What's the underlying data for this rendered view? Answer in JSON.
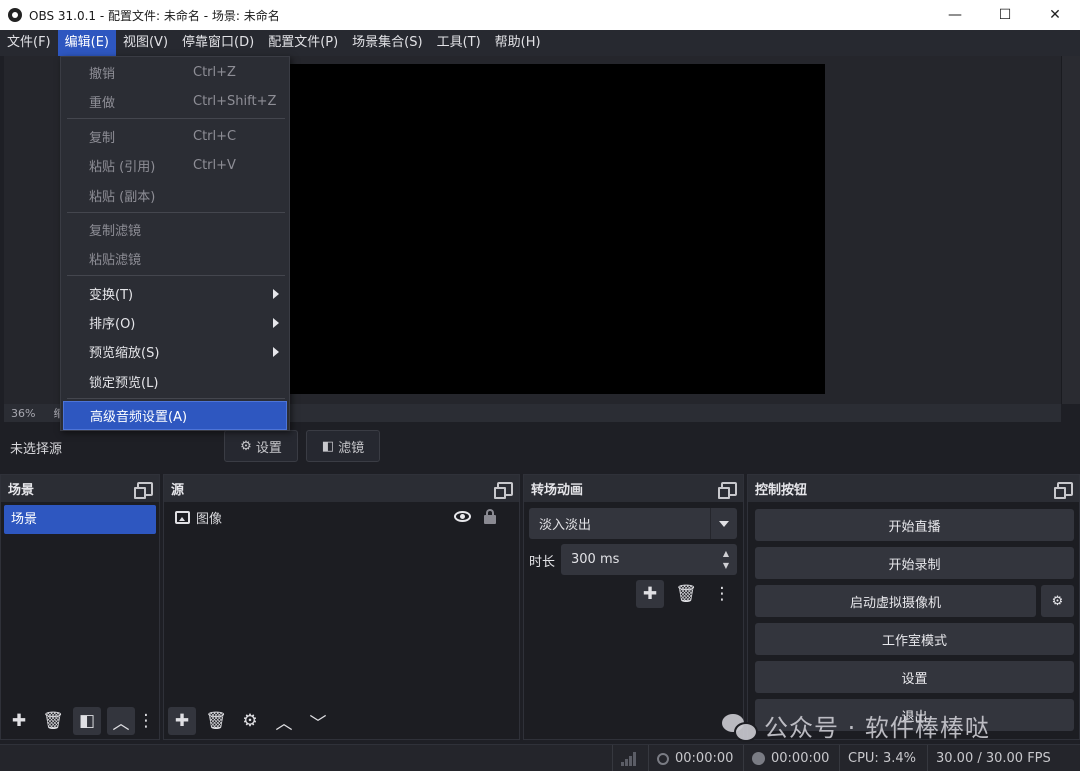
{
  "window": {
    "title": "OBS 31.0.1 - 配置文件: 未命名 - 场景: 未命名",
    "minimize": "—",
    "maximize": "☐",
    "close": "✕"
  },
  "menubar": {
    "items": [
      "文件(F)",
      "编辑(E)",
      "视图(V)",
      "停靠窗口(D)",
      "配置文件(P)",
      "场景集合(S)",
      "工具(T)",
      "帮助(H)"
    ],
    "active_index": 1
  },
  "edit_menu": {
    "undo": {
      "label": "撤销",
      "shortcut": "Ctrl+Z"
    },
    "redo": {
      "label": "重做",
      "shortcut": "Ctrl+Shift+Z"
    },
    "copy": {
      "label": "复制",
      "shortcut": "Ctrl+C"
    },
    "paste_ref": {
      "label": "粘贴 (引用)",
      "shortcut": "Ctrl+V"
    },
    "paste_dup": {
      "label": "粘贴 (副本)"
    },
    "copy_filters": {
      "label": "复制滤镜"
    },
    "paste_filters": {
      "label": "粘贴滤镜"
    },
    "transform": {
      "label": "变换(T)"
    },
    "order": {
      "label": "排序(O)"
    },
    "preview_scale": {
      "label": "预览缩放(S)"
    },
    "lock_preview": {
      "label": "锁定预览(L)"
    },
    "advanced_audio": {
      "label": "高级音频设置(A)"
    }
  },
  "preview": {
    "zoom": "36%",
    "zoom_suffix": "缩"
  },
  "source_toolbar": {
    "no_source": "未选择源",
    "settings": "设置",
    "filters": "滤镜"
  },
  "docks": {
    "scenes": {
      "title": "场景",
      "items": [
        "场景"
      ]
    },
    "sources": {
      "title": "源",
      "items": [
        "图像"
      ]
    },
    "transitions": {
      "title": "转场动画",
      "selected": "淡入淡出",
      "duration_label": "时长",
      "duration_value": "300 ms"
    },
    "controls": {
      "title": "控制按钮",
      "start_streaming": "开始直播",
      "start_recording": "开始录制",
      "virtual_camera": "启动虚拟摄像机",
      "studio_mode": "工作室模式",
      "settings": "设置",
      "exit": "退出"
    }
  },
  "statusbar": {
    "stream_time": "00:00:00",
    "rec_time": "00:00:00",
    "cpu": "CPU: 3.4%",
    "fps": "30.00 / 30.00 FPS"
  },
  "watermark": {
    "text": "公众号 · 软件棒棒哒"
  },
  "colors": {
    "accent": "#2e57c0",
    "background": "#1e1f25",
    "panel": "#2b2d34"
  }
}
